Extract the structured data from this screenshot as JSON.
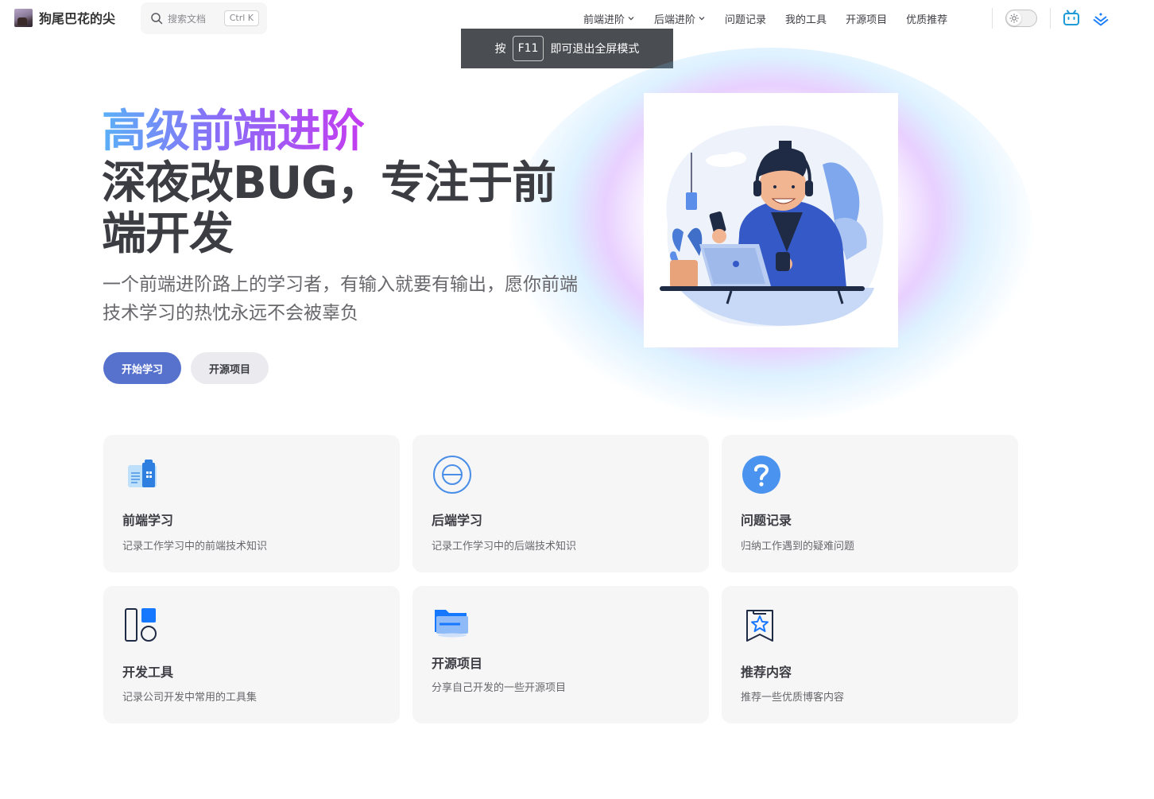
{
  "nav": {
    "title": "狗尾巴花的尖",
    "search": {
      "placeholder": "搜索文档",
      "shortcut": "Ctrl K"
    },
    "items": [
      {
        "label": "前端进阶",
        "dropdown": true
      },
      {
        "label": "后端进阶",
        "dropdown": true
      },
      {
        "label": "问题记录",
        "dropdown": false
      },
      {
        "label": "我的工具",
        "dropdown": false
      },
      {
        "label": "开源项目",
        "dropdown": false
      },
      {
        "label": "优质推荐",
        "dropdown": false
      }
    ],
    "social": [
      "bilibili-icon",
      "juejin-icon"
    ]
  },
  "toast": {
    "prefix": "按",
    "key": "F11",
    "suffix": "即可退出全屏模式"
  },
  "hero": {
    "name": "高级前端进阶",
    "text": "深夜改BUG，专注于前端开发",
    "tagline": "一个前端进阶路上的学习者，有输入就要有输出，愿你前端技术学习的热忱永远不会被辜负",
    "actions": [
      {
        "label": "开始学习",
        "theme": "brand"
      },
      {
        "label": "开源项目",
        "theme": "alt"
      }
    ]
  },
  "features": [
    {
      "title": "前端学习",
      "desc": "记录工作学习中的前端技术知识",
      "icon": "book-icon"
    },
    {
      "title": "后端学习",
      "desc": "记录工作学习中的后端技术知识",
      "icon": "backend-circle-icon"
    },
    {
      "title": "问题记录",
      "desc": "归纳工作遇到的疑难问题",
      "icon": "question-icon"
    },
    {
      "title": "开发工具",
      "desc": "记录公司开发中常用的工具集",
      "icon": "tools-icon"
    },
    {
      "title": "开源项目",
      "desc": "分享自己开发的一些开源项目",
      "icon": "folder-icon"
    },
    {
      "title": "推荐内容",
      "desc": "推荐一些优质博客内容",
      "icon": "star-badge-icon"
    }
  ],
  "colors": {
    "brand": "#5672cd",
    "accent_gradient": [
      "#5ab0f7",
      "#8b6cf7",
      "#c43cf0"
    ]
  }
}
